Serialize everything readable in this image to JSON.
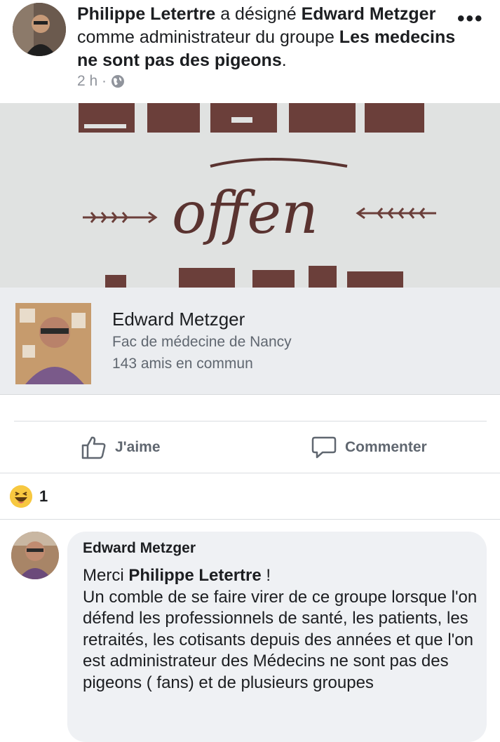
{
  "post": {
    "actor": "Philippe Letertre",
    "verb": " a désigné ",
    "target": "Edward Metzger",
    "middle": " comme administrateur du groupe ",
    "group": "Les medecins ne sont pas des pigeons",
    "end": ".",
    "time": "2 h ·",
    "more": "•••"
  },
  "cover": {
    "word": "offen"
  },
  "profile_card": {
    "name": "Edward Metzger",
    "school": "Fac de médecine de Nancy",
    "mutual": "143 amis en commun"
  },
  "actions": {
    "like": "J'aime",
    "comment": "Commenter"
  },
  "reactions": {
    "count": "1"
  },
  "comment": {
    "author": "Edward Metzger",
    "prefix": "Merci ",
    "mention": "Philippe Letertre",
    "after_mention": " !",
    "text": "Un comble de se faire virer de ce groupe lorsque l'on défend les professionnels de santé, les patients, les retraités, les cotisants depuis des années et que l'on est administrateur des Médecins ne sont pas des pigeons ( fans) et de plusieurs groupes"
  },
  "colors": {
    "background": "#ffffff",
    "card": "#ebedf0",
    "bubble": "#eff1f4",
    "muted": "#606770",
    "meta": "#90949c"
  }
}
